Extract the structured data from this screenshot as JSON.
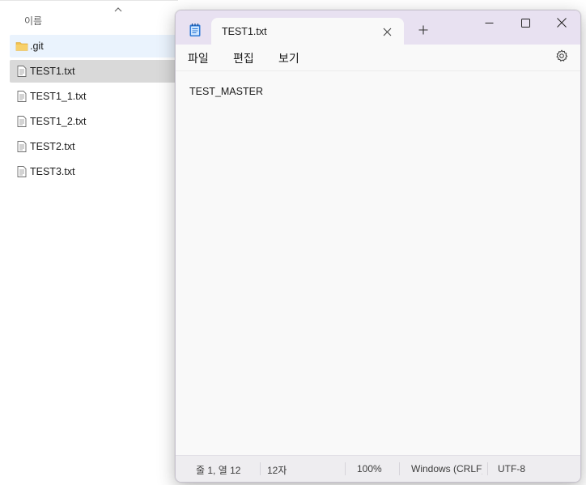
{
  "explorer": {
    "column_header": "이름",
    "files": [
      {
        "name": ".git",
        "type": "folder",
        "icon": "folder-icon",
        "state": "hover"
      },
      {
        "name": "TEST1.txt",
        "type": "text",
        "icon": "text-file-icon",
        "state": "selected"
      },
      {
        "name": "TEST1_1.txt",
        "type": "text",
        "icon": "text-file-icon",
        "state": "normal"
      },
      {
        "name": "TEST1_2.txt",
        "type": "text",
        "icon": "text-file-icon",
        "state": "normal"
      },
      {
        "name": "TEST2.txt",
        "type": "text",
        "icon": "text-file-icon",
        "state": "normal"
      },
      {
        "name": "TEST3.txt",
        "type": "text",
        "icon": "text-file-icon",
        "state": "normal"
      }
    ]
  },
  "notepad": {
    "tab_title": "TEST1.txt",
    "menu": {
      "file": "파일",
      "edit": "편집",
      "view": "보기"
    },
    "content": "TEST_MASTER",
    "status": {
      "position": "줄 1, 열 12",
      "char_count": "12자",
      "zoom": "100%",
      "line_ending": "Windows (CRLF)",
      "encoding": "UTF-8"
    }
  },
  "colors": {
    "titlebar": "#e8e1f1",
    "selected_row": "#d9d9d9",
    "hover_row": "#eaf3fd",
    "folder": "#f2c14e",
    "notepad_icon": "#2f7ad6"
  }
}
